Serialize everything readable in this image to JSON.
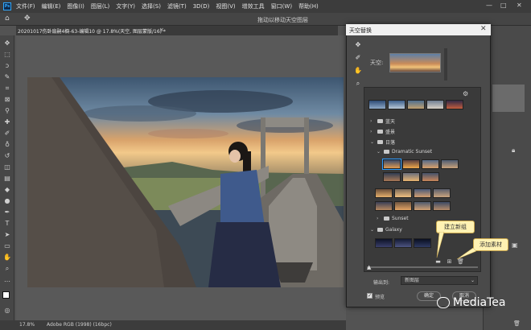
{
  "app": {
    "logo": "Ps",
    "menu": [
      "文件(F)",
      "编辑(E)",
      "图像(I)",
      "图层(L)",
      "文字(Y)",
      "选择(S)",
      "滤镜(T)",
      "3D(D)",
      "视图(V)",
      "增效工具",
      "窗口(W)",
      "帮助(H)"
    ],
    "options_title": "拖动以移动天空图层",
    "document_tab": "20201017伤卧扇嗣4橱-63-编辑10 @ 17.8%(天空, 图层蒙版/16) *"
  },
  "status": {
    "zoom": "17.8%",
    "profile": "Adobe RGB (1998) (16bpc)"
  },
  "toolbar": {
    "icons": [
      "move-icon",
      "marquee-icon",
      "lasso-icon",
      "quick-select-icon",
      "crop-icon",
      "frame-icon",
      "eyedropper-icon",
      "healing-icon",
      "brush-icon",
      "stamp-icon",
      "history-brush-icon",
      "eraser-icon",
      "gradient-icon",
      "blur-icon",
      "dodge-icon",
      "pen-icon",
      "type-icon",
      "path-select-icon",
      "shape-icon",
      "hand-icon",
      "zoom-icon",
      "more-icon"
    ],
    "glyphs": [
      "✥",
      "⬚",
      "ↄ",
      "✎",
      "⌗",
      "⊠",
      "⚲",
      "✚",
      "✐",
      "♁",
      "↺",
      "◫",
      "▤",
      "◆",
      "●",
      "✒",
      "T",
      "➤",
      "▭",
      "✋",
      "⌕",
      "…"
    ]
  },
  "dialog": {
    "title": "天空替换",
    "sky_label": "天空:",
    "groups": [
      {
        "name": "蓝天",
        "expanded": false
      },
      {
        "name": "盛景",
        "expanded": false
      },
      {
        "name": "日落",
        "expanded": true
      },
      {
        "name": "Dramatic Sunset",
        "expanded": true
      },
      {
        "name": "Sunset",
        "expanded": false
      },
      {
        "name": "Galaxy",
        "expanded": true
      }
    ],
    "output_label": "输出到:",
    "output_value": "新图层",
    "preview_label": "预览",
    "preview_checked": true,
    "ok_label": "确定",
    "cancel_label": "取消"
  },
  "callouts": {
    "new_group": "建立新组",
    "add_material": "添加素材"
  },
  "watermark": {
    "text": "MediaTea"
  },
  "colors": {
    "accent": "#31a8ff",
    "callout_bg": "#fff2b3"
  }
}
